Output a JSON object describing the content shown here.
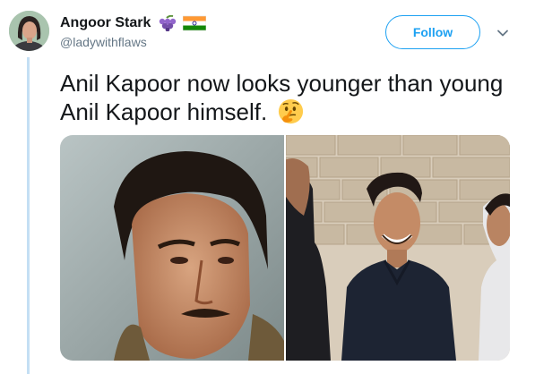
{
  "user": {
    "display_name": "Angoor Stark",
    "handle": "@ladywithflaws",
    "name_icons": [
      "grapes-icon",
      "india-flag-icon"
    ]
  },
  "actions": {
    "follow_label": "Follow",
    "more_icon": "chevron-down-icon"
  },
  "tweet": {
    "text": "Anil Kapoor now looks younger than young Anil Kapoor himself.",
    "trailing_emoji": "thinking-face-icon"
  },
  "media": {
    "count": 2,
    "photos": [
      "photo-young-anil-kapoor",
      "photo-group-stone-wall"
    ]
  },
  "colors": {
    "accent": "#1da1f2",
    "thread_line": "#c4dff4",
    "secondary_text": "#657786",
    "primary_text": "#14171a"
  }
}
